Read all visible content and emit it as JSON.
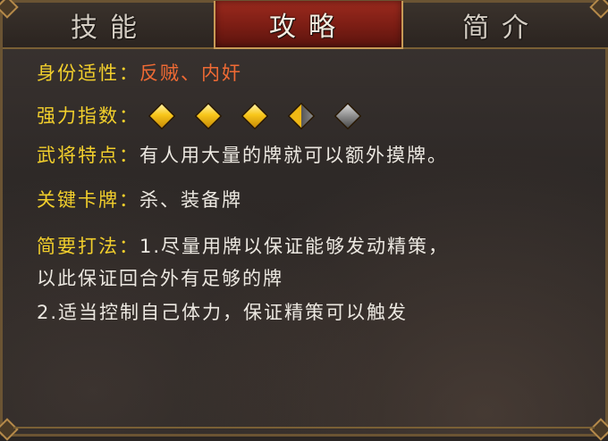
{
  "tabs": [
    {
      "label": "技能",
      "active": false
    },
    {
      "label": "攻略",
      "active": true
    },
    {
      "label": "简介",
      "active": false
    }
  ],
  "identity": {
    "label": "身份适性：",
    "value": "反贼、内奸"
  },
  "strength": {
    "label": "强力指数：",
    "rating": 3.5,
    "max": 5
  },
  "traits": {
    "label": "武将特点：",
    "value": "有人用大量的牌就可以额外摸牌。"
  },
  "key_cards": {
    "label": "关键卡牌：",
    "value": "杀、装备牌"
  },
  "strategy": {
    "label": "简要打法：",
    "line1": "1.尽量用牌以保证能够发动精策，",
    "line2": "以此保证回合外有足够的牌",
    "line3": "2.适当控制自己体力，保证精策可以触发"
  },
  "colors": {
    "label": "#f2cf2c",
    "value": "#ece8e1",
    "identity": "#ef6a34",
    "active_tab": "#8a2218"
  },
  "icons": {
    "rating_full": "gold-diamond-icon",
    "rating_half": "half-gold-diamond-icon",
    "rating_empty": "gray-diamond-icon"
  }
}
